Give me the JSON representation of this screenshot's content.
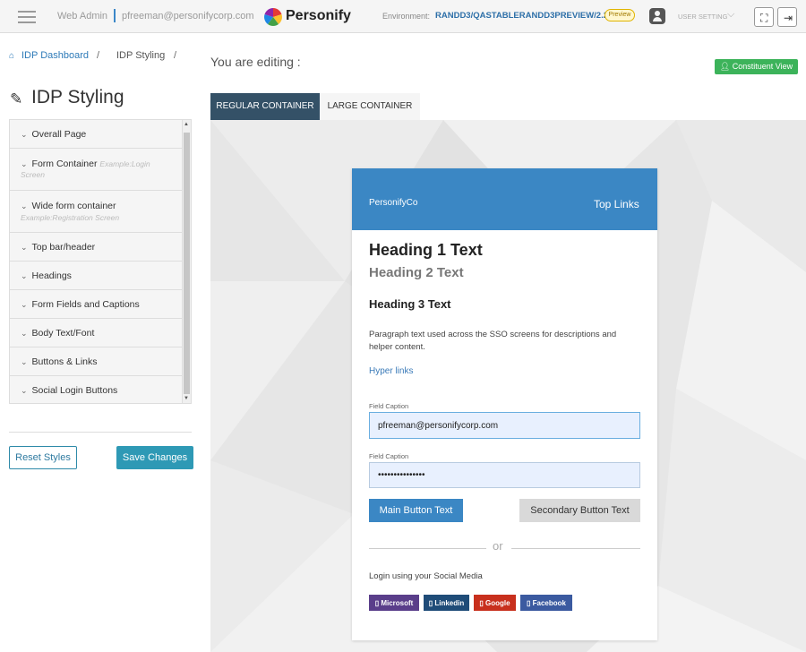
{
  "topbar": {
    "app_name": "Web Admin",
    "user_email": "pfreeman@personifycorp.com",
    "brand": "Personify",
    "env_label": "Environment:",
    "env_value": "RANDD3/QASTABLERANDD3PREVIEW/2.20.0",
    "preview_badge": "Preview",
    "user_setting": "USER SETTING",
    "icons": [
      "hamburger-icon",
      "personify-logo",
      "user-icon",
      "chevron-down-icon",
      "fullscreen-icon",
      "logout-icon"
    ]
  },
  "breadcrumb": {
    "home_icon": "home-icon",
    "dashboard": "IDP Dashboard",
    "separator": "/",
    "current": "IDP Styling"
  },
  "panel": {
    "title": "IDP Styling",
    "title_icon": "paintbrush-icon",
    "sections": [
      {
        "label": "Overall Page",
        "example": ""
      },
      {
        "label": "Form Container",
        "example": "Example:Login Screen"
      },
      {
        "label": "Wide form container",
        "example": "Example:Registration Screen"
      },
      {
        "label": "Top bar/header",
        "example": ""
      },
      {
        "label": "Headings",
        "example": ""
      },
      {
        "label": "Form Fields and Captions",
        "example": ""
      },
      {
        "label": "Body Text/Font",
        "example": ""
      },
      {
        "label": "Buttons & Links",
        "example": ""
      },
      {
        "label": "Social Login Buttons",
        "example": ""
      }
    ],
    "reset_label": "Reset Styles",
    "save_label": "Save Changes"
  },
  "editor": {
    "editing_label": "You are editing :",
    "constituent_label": "Constituent View",
    "tabs": [
      {
        "label": "REGULAR CONTAINER",
        "active": true
      },
      {
        "label": "LARGE CONTAINER",
        "active": false
      }
    ]
  },
  "preview": {
    "brand": "PersonifyCo",
    "top_links": "Top Links",
    "heading1": "Heading 1 Text",
    "heading2": "Heading 2 Text",
    "heading3": "Heading 3 Text",
    "paragraph": "Paragraph text used across the SSO screens for descriptions and helper content.",
    "hyperlink": "Hyper links",
    "field1_caption": "Field Caption",
    "field1_value": "pfreeman@personifycorp.com",
    "field2_caption": "Field Caption",
    "field2_value": "•••••••••••••••",
    "main_button": "Main Button Text",
    "secondary_button": "Secondary Button Text",
    "or_text": "or",
    "social_label": "Login using your Social Media",
    "social_buttons": [
      {
        "label": "▯ Microsoft",
        "color": "#5a3e8a"
      },
      {
        "label": "▯ Linkedin",
        "color": "#1f4c78"
      },
      {
        "label": "▯ Google",
        "color": "#c8301d"
      },
      {
        "label": "▯ Facebook",
        "color": "#3b5aa0"
      }
    ]
  },
  "colors": {
    "primary": "#3b87c4",
    "tab_active": "#345167",
    "save": "#2e99b5",
    "constituent": "#3cb35a",
    "link": "#2d7ab8"
  }
}
